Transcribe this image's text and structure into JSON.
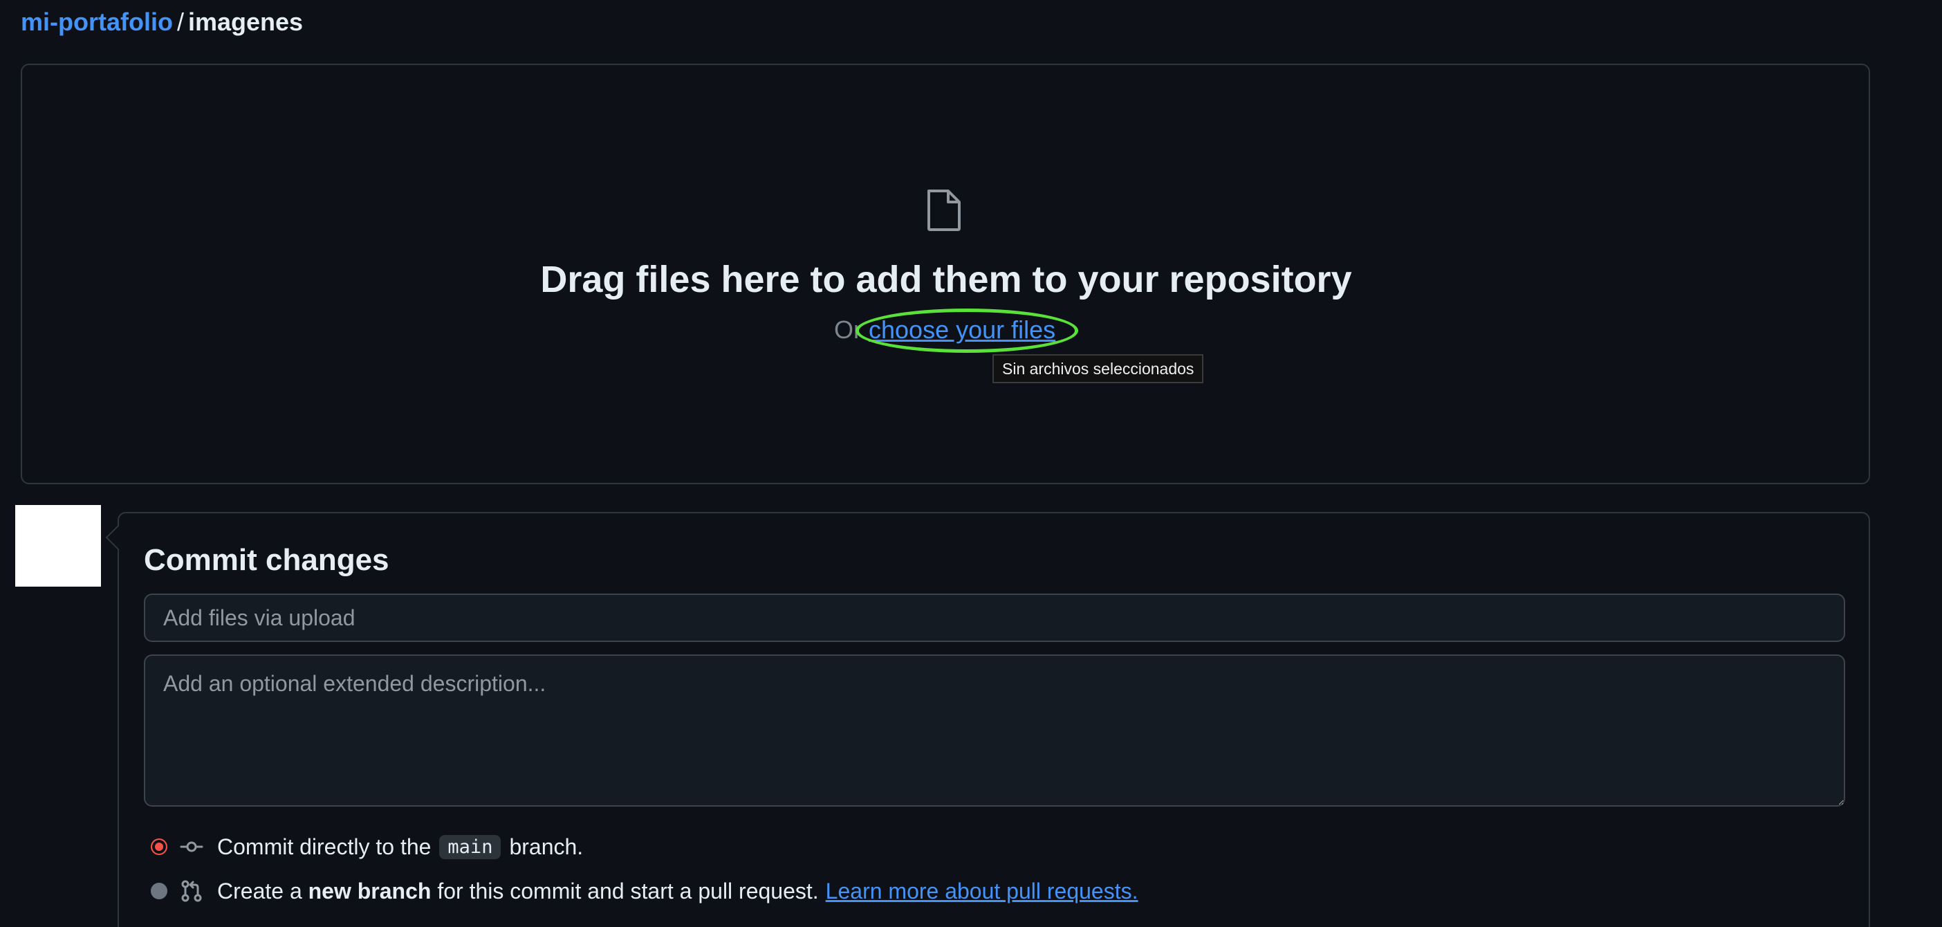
{
  "breadcrumb": {
    "repo": "mi-portafolio",
    "separator": "/",
    "directory": "imagenes"
  },
  "dropzone": {
    "icon": "file-icon",
    "title": "Drag files here to add them to your repository",
    "prefix": "Or",
    "choose_link": "choose your files",
    "file_status_tooltip": "Sin archivos seleccionados",
    "highlight_color": "#5ae13a"
  },
  "commit": {
    "title": "Commit changes",
    "summary_placeholder": "Add files via upload",
    "summary_value": "",
    "description_placeholder": "Add an optional extended description...",
    "option_direct": {
      "selected": true,
      "icon": "git-commit-icon",
      "text_before": "Commit directly to the",
      "branch": "main",
      "text_after": "branch."
    },
    "option_new_branch": {
      "selected": false,
      "icon": "git-pull-request-icon",
      "text_before": "Create a",
      "bold": "new branch",
      "text_after": "for this commit and start a pull request.",
      "link": "Learn more about pull requests."
    }
  },
  "colors": {
    "background": "#0d1117",
    "link": "#4493f8",
    "border": "#30363d",
    "radio_selected": "#f85149"
  }
}
